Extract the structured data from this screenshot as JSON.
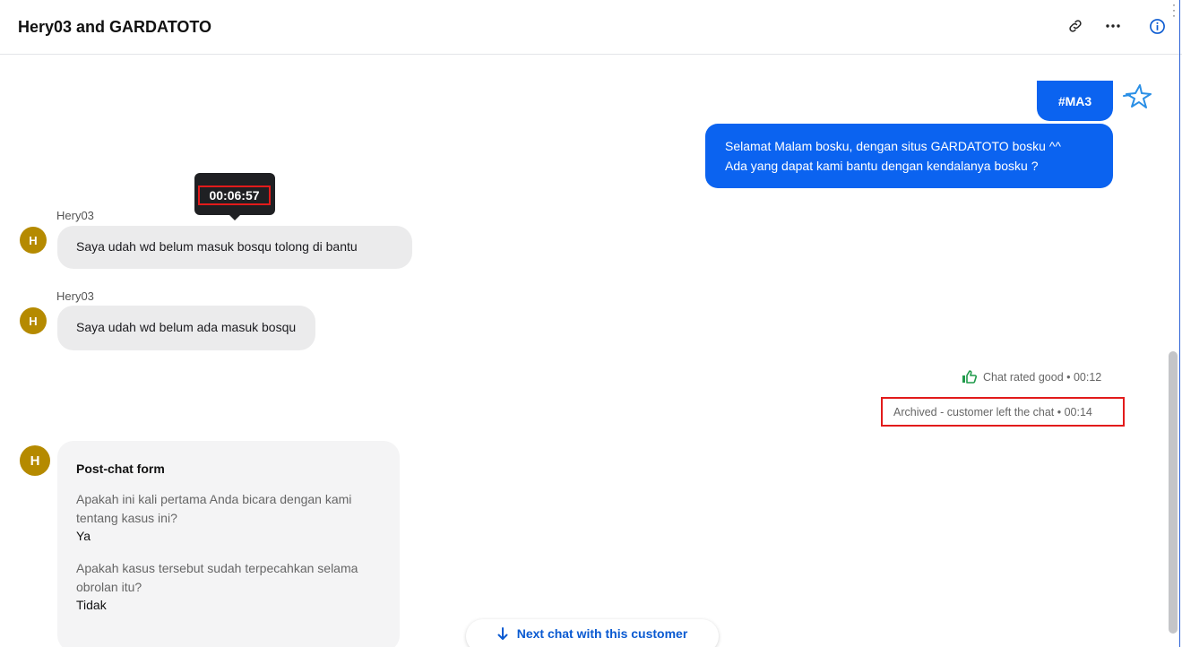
{
  "header": {
    "title": "Hery03 and GARDATOTO",
    "icons": [
      "link-icon",
      "more-icon",
      "info-icon"
    ]
  },
  "colors": {
    "agent_bubble": "#0b63f0",
    "customer_bubble": "#ebebec",
    "avatar": "#b58a00",
    "highlight": "#e21b1b",
    "link": "#0a5ad1"
  },
  "messages": {
    "agent_tag": "#MA3",
    "agent_greeting_line1": "Selamat Malam bosku, dengan situs GARDATOTO bosku ^^",
    "agent_greeting_line2": "Ada yang dapat kami bantu dengan kendalanya bosku ?",
    "tooltip_time": "00:06:57",
    "customer_1_name": "Hery03",
    "customer_1_avatar": "H",
    "customer_1_text": "Saya udah wd belum masuk bosqu tolong di bantu",
    "customer_2_name": "Hery03",
    "customer_2_avatar": "H",
    "customer_2_text": "Saya udah wd belum ada masuk bosqu"
  },
  "events": {
    "rated": "Chat rated good • 00:12",
    "archived": "Archived - customer left the chat • 00:14"
  },
  "post_chat_form": {
    "avatar": "H",
    "title": "Post-chat form",
    "q1": "Apakah ini kali pertama Anda bicara dengan kami tentang kasus ini?",
    "a1": "Ya",
    "q2": "Apakah kasus tersebut sudah terpecahkan selama obrolan itu?",
    "a2": "Tidak"
  },
  "next_chat_button": "Next chat with this customer"
}
